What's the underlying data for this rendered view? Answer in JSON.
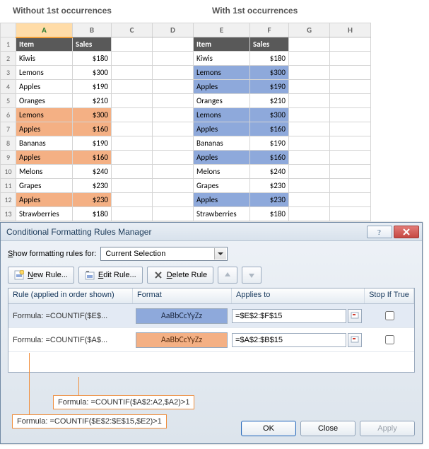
{
  "labels": {
    "left": "Without 1st occurrences",
    "right": "With 1st occurrences"
  },
  "columns": [
    "A",
    "B",
    "C",
    "D",
    "E",
    "F",
    "G",
    "H"
  ],
  "headers": {
    "item": "Item",
    "sales": "Sales"
  },
  "rows": [
    {
      "a": "Kiwis",
      "b": "$180",
      "e": "Kiwis",
      "f": "$180",
      "hi_ab": false,
      "hi_ef": false
    },
    {
      "a": "Lemons",
      "b": "$300",
      "e": "Lemons",
      "f": "$300",
      "hi_ab": false,
      "hi_ef": true
    },
    {
      "a": "Apples",
      "b": "$190",
      "e": "Apples",
      "f": "$190",
      "hi_ab": false,
      "hi_ef": true
    },
    {
      "a": "Oranges",
      "b": "$210",
      "e": "Oranges",
      "f": "$210",
      "hi_ab": false,
      "hi_ef": false
    },
    {
      "a": "Lemons",
      "b": "$300",
      "e": "Lemons",
      "f": "$300",
      "hi_ab": true,
      "hi_ef": true
    },
    {
      "a": "Apples",
      "b": "$160",
      "e": "Apples",
      "f": "$160",
      "hi_ab": true,
      "hi_ef": true
    },
    {
      "a": "Bananas",
      "b": "$190",
      "e": "Bananas",
      "f": "$190",
      "hi_ab": false,
      "hi_ef": false
    },
    {
      "a": "Apples",
      "b": "$160",
      "e": "Apples",
      "f": "$160",
      "hi_ab": true,
      "hi_ef": true
    },
    {
      "a": "Melons",
      "b": "$240",
      "e": "Melons",
      "f": "$240",
      "hi_ab": false,
      "hi_ef": false
    },
    {
      "a": "Grapes",
      "b": "$230",
      "e": "Grapes",
      "f": "$230",
      "hi_ab": false,
      "hi_ef": false
    },
    {
      "a": "Apples",
      "b": "$230",
      "e": "Apples",
      "f": "$230",
      "hi_ab": true,
      "hi_ef": true
    },
    {
      "a": "Strawberries",
      "b": "$180",
      "e": "Strawberries",
      "f": "$180",
      "hi_ab": false,
      "hi_ef": false
    }
  ],
  "dialog": {
    "title": "Conditional Formatting Rules Manager",
    "show_label_pre": "S",
    "show_label_post": "how formatting rules for:",
    "scope": "Current Selection",
    "buttons": {
      "new_pre": "N",
      "new_post": "ew Rule...",
      "edit_pre": "E",
      "edit_post": "dit Rule...",
      "delete_pre": "D",
      "delete_post": "elete Rule"
    },
    "grid_h": {
      "rule": "Rule (applied in order shown)",
      "format": "Format",
      "applies": "Applies to",
      "stop": "Stop If True"
    },
    "preview_sample": "AaBbCcYyZz",
    "rules": [
      {
        "rule": "Formula: =COUNTIF($E$...",
        "preview_class": "pblue",
        "applies": "=$E$2:$F$15"
      },
      {
        "rule": "Formula: =COUNTIF($A$...",
        "preview_class": "porange",
        "applies": "=$A$2:$B$15"
      }
    ],
    "footer": {
      "ok": "OK",
      "close": "Close",
      "apply": "Apply"
    }
  },
  "callouts": {
    "c1": "Formula: =COUNTIF($A$2:A2,$A2)>1",
    "c2": "Formula: =COUNTIF($E$2:$E$15,$E2)>1"
  }
}
